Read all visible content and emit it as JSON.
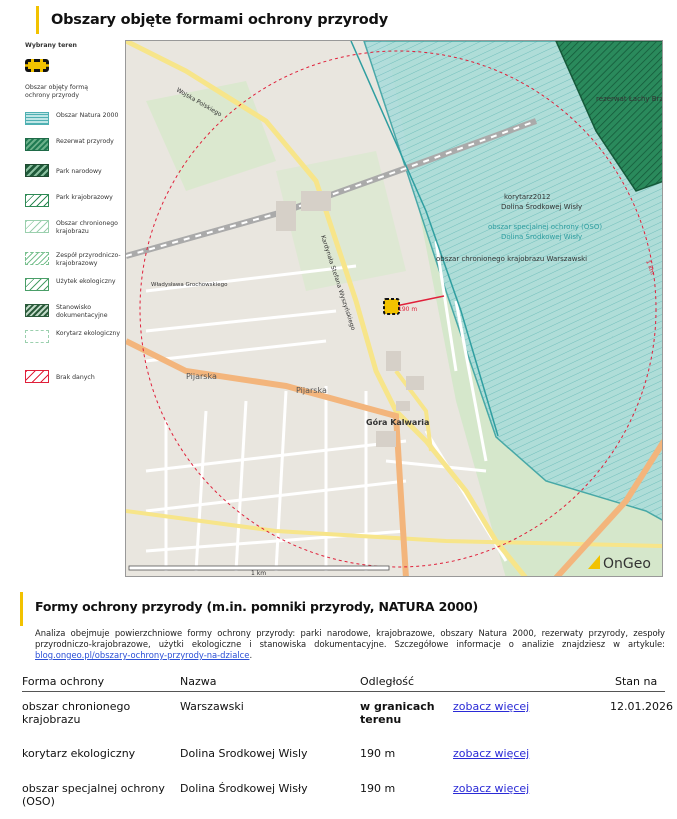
{
  "header": {
    "title": "Obszary objęte formami ochrony przyrody"
  },
  "legend": {
    "title": "Wybrany teren",
    "items": [
      {
        "label": "Obszar objęty formą ochrony przyrody"
      },
      {
        "label": "Obszar Natura 2000"
      },
      {
        "label": "Rezerwat przyrody"
      },
      {
        "label": "Park narodowy"
      },
      {
        "label": "Park krajobrazowy"
      },
      {
        "label": "Obszar chronionego krajobrazu"
      },
      {
        "label": "Zespół przyrodniczo-krajobrazowy"
      },
      {
        "label": "Użytek ekologiczny"
      },
      {
        "label": "Stanowisko dokumentacyjne"
      },
      {
        "label": "Korytarz ekologiczny"
      },
      {
        "label": "Brak danych"
      }
    ]
  },
  "map": {
    "labels": {
      "reserve": "rezerwat Łachy Brzeskie",
      "corridor1": "korytarz2012",
      "corridor2": "Dolina Środkowej Wisły",
      "oso1": "obszar specjalnej ochrony (OSO)",
      "oso2": "Dolina Środkowej Wisły",
      "okk": "obszar chronionego krajobrazu Warszawski",
      "town": "Góra Kalwaria",
      "street_pijarska1": "Pijarska",
      "street_pijarska2": "Pijarska",
      "street_wojska": "Wojska Polskiego",
      "street_kardynala": "Kardynała Stefana Wyszyńskiego",
      "street_grochowskiego": "Władysława Grochowskiego",
      "street_dist": "190 m",
      "radius": "1 km",
      "scale": "1 km",
      "brand": "OnGeo"
    },
    "colors": {
      "natura": "#8ccfd0",
      "reserve": "#1f7a52",
      "boundary": "#e0203a",
      "road": "#f3b57c"
    }
  },
  "section": {
    "title": "Formy ochrony przyrody (m.in. pomniki przyrody, NATURA 2000)",
    "desc": "Analiza obejmuje powierzchniowe formy ochrony przyrody: parki narodowe, krajobrazowe, obszary Natura 2000, rezerwaty przyrody, zespoły przyrodniczo-krajobrazowe, użytki ekologiczne i stanowiska dokumentacyjne. Szczegółowe informacje o analizie znajdziesz w artykule: ",
    "link": "blog.ongeo.pl/obszary-ochrony-przyrody-na-dzialce",
    "after": "."
  },
  "table": {
    "headers": {
      "forma": "Forma ochrony",
      "nazwa": "Nazwa",
      "odl": "Odległość",
      "stan": "Stan na"
    },
    "stan_value": "12.01.2026",
    "rows": [
      {
        "forma": "obszar chronionego krajobrazu",
        "nazwa": "Warszawski",
        "odl": "w granicach terenu",
        "link": "zobacz więcej"
      },
      {
        "forma": "korytarz ekologiczny",
        "nazwa": "Dolina Srodkowej Wisly",
        "odl": "190 m",
        "link": "zobacz więcej"
      },
      {
        "forma": "obszar specjalnej ochrony (OSO)",
        "nazwa": "Dolina Środkowej Wisły",
        "odl": "190 m",
        "link": "zobacz więcej"
      }
    ]
  }
}
